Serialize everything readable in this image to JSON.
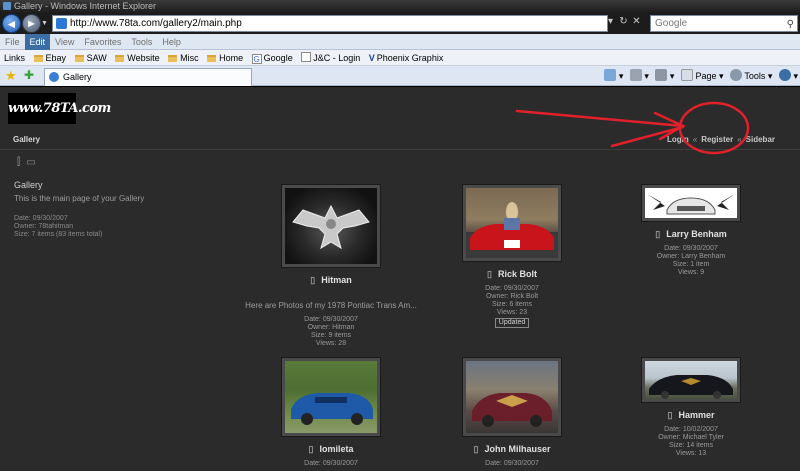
{
  "browser": {
    "title": "Gallery - Windows Internet Explorer",
    "url": "http://www.78ta.com/gallery2/main.php",
    "search_placeholder": "Google",
    "menu": [
      "File",
      "Edit",
      "View",
      "Favorites",
      "Tools",
      "Help"
    ],
    "active_menu": "Edit",
    "links_label": "Links",
    "links": [
      {
        "label": "Ebay",
        "icon": "folder-icon"
      },
      {
        "label": "SAW",
        "icon": "folder-icon"
      },
      {
        "label": "Website",
        "icon": "folder-icon"
      },
      {
        "label": "Misc",
        "icon": "folder-icon"
      },
      {
        "label": "Home",
        "icon": "folder-icon"
      },
      {
        "label": "Google",
        "icon": "google-icon"
      },
      {
        "label": "J&C - Login",
        "icon": "page-icon"
      },
      {
        "label": "Phoenix Graphix",
        "icon": "v-icon"
      }
    ],
    "tab_title": "Gallery",
    "commands": {
      "page": "Page",
      "tools": "Tools"
    }
  },
  "site": {
    "logo_text": "www.78TA.com",
    "breadcrumb": "Gallery",
    "user_links": {
      "login": "Login",
      "register": "Register",
      "sidebar": "Sidebar",
      "sep": "«"
    }
  },
  "sidebar": {
    "title": "Gallery",
    "description": "This is the main page of your Gallery",
    "date": "Date: 09/30/2007",
    "owner": "Owner: 78tahitman",
    "size": "Size: 7 items (83 items total)"
  },
  "albums": [
    {
      "title": "Hitman",
      "description": "Here are Photos of my 1978 Pontiac Trans Am...",
      "date": "Date: 09/30/2007",
      "owner": "Owner: Hitman",
      "size": "Size: 9 items",
      "views": "Views: 28",
      "badge": ""
    },
    {
      "title": "Rick Bolt",
      "description": "",
      "date": "Date: 09/30/2007",
      "owner": "Owner: Rick Bolt",
      "size": "Size: 6 items",
      "views": "Views: 23",
      "badge": "Updated"
    },
    {
      "title": "Larry Benham",
      "description": "",
      "date": "Date: 09/30/2007",
      "owner": "Owner: Larry Benham",
      "size": "Size: 1 item",
      "views": "Views: 9",
      "badge": ""
    },
    {
      "title": "Iomileta",
      "description": "",
      "date": "Date: 09/30/2007",
      "owner": "",
      "size": "",
      "views": "",
      "badge": ""
    },
    {
      "title": "John Milhauser",
      "description": "",
      "date": "Date: 09/30/2007",
      "owner": "",
      "size": "",
      "views": "",
      "badge": ""
    },
    {
      "title": "Hammer",
      "description": "",
      "date": "Date: 10/02/2007",
      "owner": "Owner: Michael Tyler",
      "size": "Size: 14 items",
      "views": "Views: 13",
      "badge": ""
    }
  ],
  "colors": {
    "page_bg": "#2b2b2b",
    "annotation": "#e0202a",
    "ie_blue": "#3a6ea5"
  }
}
